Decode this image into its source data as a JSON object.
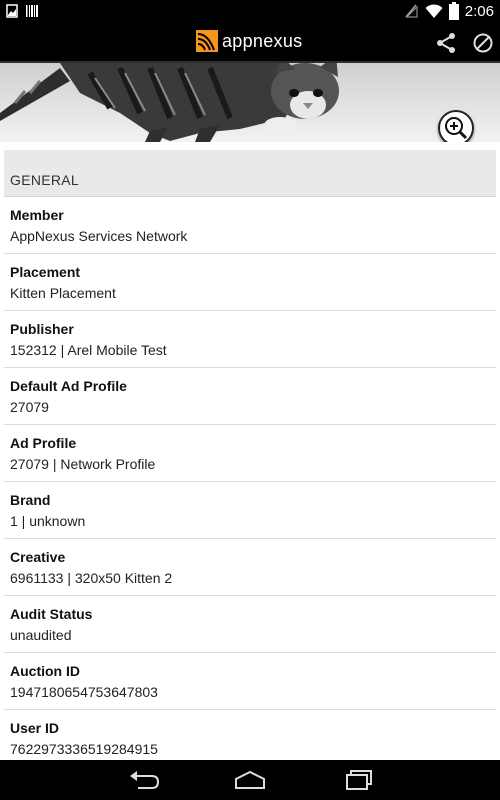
{
  "status_bar": {
    "time": "2:06",
    "left_icons": [
      "image-notification-icon",
      "barcode-notification-icon"
    ],
    "right_icons": [
      "no-signal-icon",
      "wifi-icon",
      "battery-icon"
    ]
  },
  "app_bar": {
    "logo_text": "appnexus",
    "logo_color": "#f7941d",
    "actions": [
      "share-icon",
      "block-icon"
    ]
  },
  "banner": {
    "zoom_icon": "zoom-in-icon"
  },
  "section": {
    "title": "GENERAL"
  },
  "fields": [
    {
      "label": "Member",
      "value": "AppNexus Services Network"
    },
    {
      "label": "Placement",
      "value": "Kitten Placement"
    },
    {
      "label": "Publisher",
      "value": "152312 | Arel Mobile Test"
    },
    {
      "label": "Default Ad Profile",
      "value": "27079"
    },
    {
      "label": "Ad Profile",
      "value": "27079 | Network Profile"
    },
    {
      "label": "Brand",
      "value": "1 | unknown"
    },
    {
      "label": "Creative",
      "value": "6961133 | 320x50 Kitten 2"
    },
    {
      "label": "Audit Status",
      "value": "unaudited"
    },
    {
      "label": "Auction ID",
      "value": "1947180654753647803"
    },
    {
      "label": "User ID",
      "value": "7622973336519284915"
    }
  ],
  "nav_bar": [
    "back-icon",
    "home-icon",
    "recents-icon"
  ]
}
